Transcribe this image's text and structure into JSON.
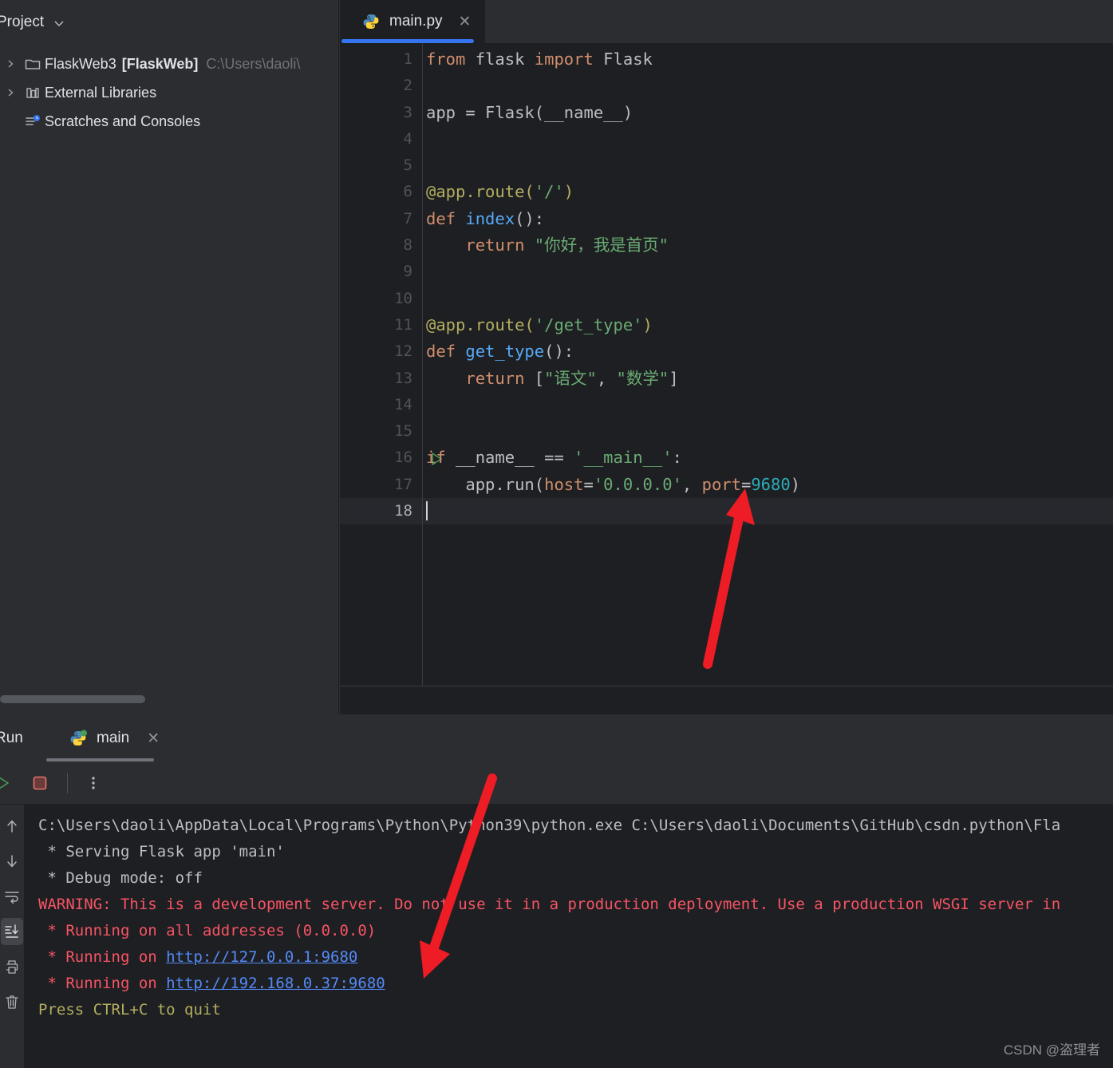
{
  "project": {
    "header_title": "Project",
    "chevron_icon": "chevron-down-icon",
    "tree": [
      {
        "arrow": "chevron-right-icon",
        "icon": "folder-icon",
        "label": "FlaskWeb3",
        "bold_label": "[FlaskWeb]",
        "dim_label": "C:\\Users\\daoli\\"
      },
      {
        "arrow": "chevron-right-icon",
        "icon": "libraries-icon",
        "label": "External Libraries",
        "bold_label": "",
        "dim_label": ""
      },
      {
        "arrow": "",
        "icon": "scratches-icon",
        "label": "Scratches and Consoles",
        "bold_label": "",
        "dim_label": ""
      }
    ]
  },
  "editor": {
    "tab": {
      "icon": "python-file-icon",
      "label": "main.py",
      "close_icon": "close-icon",
      "active_accent": "#3574f0"
    },
    "caret_line": 18,
    "run_marker_line": 16,
    "run_marker_icon": "run-gutter-icon",
    "lines": [
      {
        "n": 1,
        "tokens": [
          {
            "c": "k",
            "t": "from"
          },
          {
            "c": "t",
            "t": " flask "
          },
          {
            "c": "k",
            "t": "import"
          },
          {
            "c": "t",
            "t": " Flask"
          }
        ]
      },
      {
        "n": 2,
        "tokens": []
      },
      {
        "n": 3,
        "tokens": [
          {
            "c": "t",
            "t": "app = Flask(__name__)"
          }
        ]
      },
      {
        "n": 4,
        "tokens": []
      },
      {
        "n": 5,
        "tokens": []
      },
      {
        "n": 6,
        "tokens": [
          {
            "c": "d",
            "t": "@app.route("
          },
          {
            "c": "s",
            "t": "'/'"
          },
          {
            "c": "d",
            "t": ")"
          }
        ]
      },
      {
        "n": 7,
        "tokens": [
          {
            "c": "k",
            "t": "def"
          },
          {
            "c": "t",
            "t": " "
          },
          {
            "c": "fn",
            "t": "index"
          },
          {
            "c": "t",
            "t": "():"
          }
        ]
      },
      {
        "n": 8,
        "tokens": [
          {
            "c": "t",
            "t": "    "
          },
          {
            "c": "k",
            "t": "return"
          },
          {
            "c": "t",
            "t": " "
          },
          {
            "c": "s",
            "t": "\"你好，我是首页\""
          }
        ]
      },
      {
        "n": 9,
        "tokens": []
      },
      {
        "n": 10,
        "tokens": []
      },
      {
        "n": 11,
        "tokens": [
          {
            "c": "d",
            "t": "@app.route("
          },
          {
            "c": "s",
            "t": "'/get_type'"
          },
          {
            "c": "d",
            "t": ")"
          }
        ]
      },
      {
        "n": 12,
        "tokens": [
          {
            "c": "k",
            "t": "def"
          },
          {
            "c": "t",
            "t": " "
          },
          {
            "c": "fn",
            "t": "get_type"
          },
          {
            "c": "t",
            "t": "():"
          }
        ]
      },
      {
        "n": 13,
        "tokens": [
          {
            "c": "t",
            "t": "    "
          },
          {
            "c": "k",
            "t": "return"
          },
          {
            "c": "t",
            "t": " ["
          },
          {
            "c": "s",
            "t": "\"语文\""
          },
          {
            "c": "t",
            "t": ", "
          },
          {
            "c": "s",
            "t": "\"数学\""
          },
          {
            "c": "t",
            "t": "]"
          }
        ]
      },
      {
        "n": 14,
        "tokens": []
      },
      {
        "n": 15,
        "tokens": []
      },
      {
        "n": 16,
        "tokens": [
          {
            "c": "k",
            "t": "if"
          },
          {
            "c": "t",
            "t": " __name__ == "
          },
          {
            "c": "s",
            "t": "'__main__'"
          },
          {
            "c": "t",
            "t": ":"
          }
        ]
      },
      {
        "n": 17,
        "tokens": [
          {
            "c": "t",
            "t": "    app.run("
          },
          {
            "c": "p",
            "t": "host"
          },
          {
            "c": "t",
            "t": "="
          },
          {
            "c": "s",
            "t": "'0.0.0.0'"
          },
          {
            "c": "t",
            "t": ", "
          },
          {
            "c": "p",
            "t": "port"
          },
          {
            "c": "t",
            "t": "="
          },
          {
            "c": "n",
            "t": "9680"
          },
          {
            "c": "t",
            "t": ")"
          }
        ]
      },
      {
        "n": 18,
        "tokens": []
      }
    ]
  },
  "run_panel": {
    "title": "Run",
    "tab": {
      "icon": "python-run-icon",
      "label": "main",
      "close_icon": "close-icon"
    },
    "toolbar": [
      {
        "name": "rerun-button",
        "icon": "run-icon"
      },
      {
        "name": "stop-button",
        "icon": "stop-icon"
      },
      {
        "name": "more-options-button",
        "icon": "vertical-dots-icon"
      }
    ],
    "console_sidebar": [
      {
        "name": "scroll-up-button",
        "icon": "arrow-up-icon",
        "active": false
      },
      {
        "name": "scroll-down-button",
        "icon": "arrow-down-icon",
        "active": false
      },
      {
        "name": "soft-wrap-button",
        "icon": "soft-wrap-icon",
        "active": false
      },
      {
        "name": "scroll-to-end-button",
        "icon": "scroll-to-end-icon",
        "active": true
      },
      {
        "name": "print-button",
        "icon": "printer-icon",
        "active": false
      },
      {
        "name": "clear-all-button",
        "icon": "trash-icon",
        "active": false
      }
    ],
    "console_lines": [
      {
        "segs": [
          {
            "c": "c-white",
            "t": "C:\\Users\\daoli\\AppData\\Local\\Programs\\Python\\Python39\\python.exe C:\\Users\\daoli\\Documents\\GitHub\\csdn.python\\Fla"
          }
        ]
      },
      {
        "segs": [
          {
            "c": "c-white",
            "t": " * Serving Flask app 'main'"
          }
        ]
      },
      {
        "segs": [
          {
            "c": "c-white",
            "t": " * Debug mode: off"
          }
        ]
      },
      {
        "segs": [
          {
            "c": "c-red",
            "t": "WARNING: This is a development server. Do not use it in a production deployment. Use a production WSGI server in"
          }
        ]
      },
      {
        "segs": [
          {
            "c": "c-salmon",
            "t": " * Running on all addresses (0.0.0.0)"
          }
        ]
      },
      {
        "segs": [
          {
            "c": "c-salmon",
            "t": " * Running on "
          },
          {
            "c": "c-link",
            "t": "http://127.0.0.1:9680"
          }
        ]
      },
      {
        "segs": [
          {
            "c": "c-salmon",
            "t": " * Running on "
          },
          {
            "c": "c-link",
            "t": "http://192.168.0.37:9680"
          }
        ]
      },
      {
        "segs": [
          {
            "c": "c-yellow",
            "t": "Press CTRL+C to quit"
          }
        ]
      }
    ]
  },
  "annotations": {
    "arrow_color": "#ee1c25",
    "arrows": [
      {
        "name": "arrow-to-port-number"
      },
      {
        "name": "arrow-to-network-url"
      }
    ]
  },
  "watermark": {
    "text": "CSDN @盗理者"
  }
}
